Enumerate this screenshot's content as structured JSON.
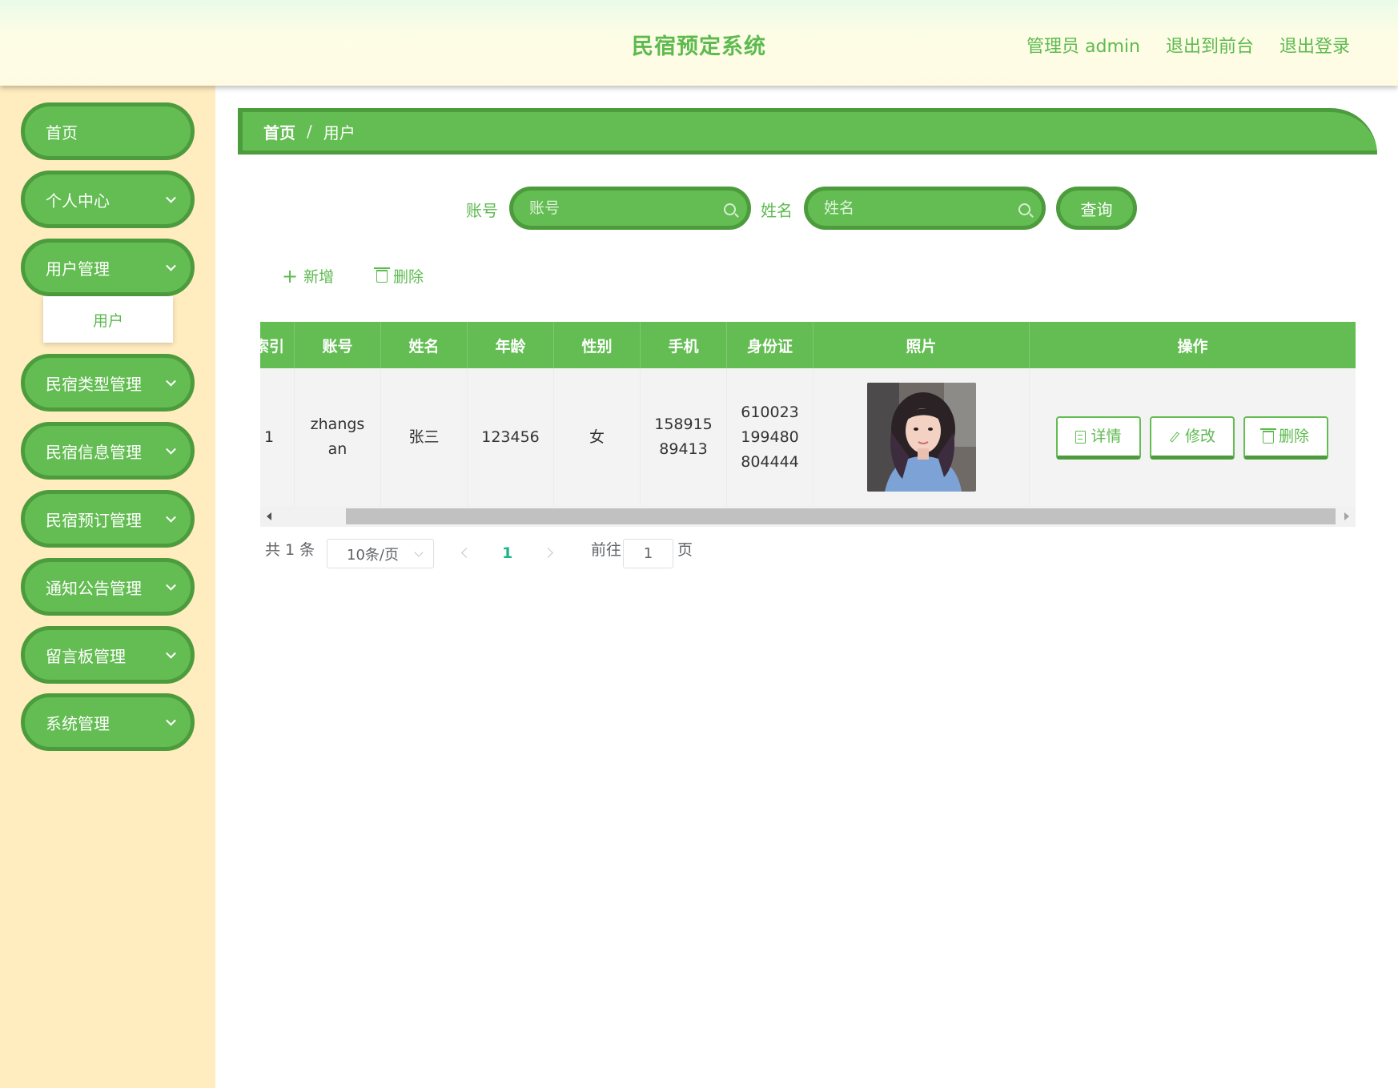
{
  "header": {
    "title": "民宿预定系统",
    "user_label": "管理员 admin",
    "to_front": "退出到前台",
    "logout": "退出登录"
  },
  "sidebar": {
    "items": [
      {
        "label": "首页",
        "has_children": false
      },
      {
        "label": "个人中心",
        "has_children": true
      },
      {
        "label": "用户管理",
        "has_children": true,
        "expanded": true
      },
      {
        "label": "民宿类型管理",
        "has_children": true
      },
      {
        "label": "民宿信息管理",
        "has_children": true
      },
      {
        "label": "民宿预订管理",
        "has_children": true
      },
      {
        "label": "通知公告管理",
        "has_children": true
      },
      {
        "label": "留言板管理",
        "has_children": true
      },
      {
        "label": "系统管理",
        "has_children": true
      }
    ],
    "submenu": {
      "label": "用户"
    }
  },
  "breadcrumb": {
    "home": "首页",
    "separator": "/",
    "current": "用户"
  },
  "search": {
    "account_label": "账号",
    "account_placeholder": "账号",
    "name_label": "姓名",
    "name_placeholder": "姓名",
    "query_button": "查询"
  },
  "actions": {
    "add": "新增",
    "delete": "删除"
  },
  "table": {
    "columns": [
      "索引",
      "账号",
      "姓名",
      "年龄",
      "性别",
      "手机",
      "身份证",
      "照片",
      "操作"
    ],
    "rows": [
      {
        "index": "1",
        "account": "zhangsan",
        "name": "张三",
        "age": "123456",
        "gender": "女",
        "phone": "15891589413",
        "id_card": "610023199480804444"
      }
    ],
    "row_buttons": {
      "detail": "详情",
      "edit": "修改",
      "delete": "删除"
    }
  },
  "pagination": {
    "total_text": "共 1 条",
    "page_size": "10条/页",
    "current_page": "1",
    "goto_label": "前往",
    "goto_value": "1",
    "page_suffix": "页"
  },
  "colors": {
    "primary": "#63bd52",
    "primary_dark": "#4c9c3d",
    "sidebar_bg": "#ffecbf",
    "page_active": "#1fb58c"
  }
}
